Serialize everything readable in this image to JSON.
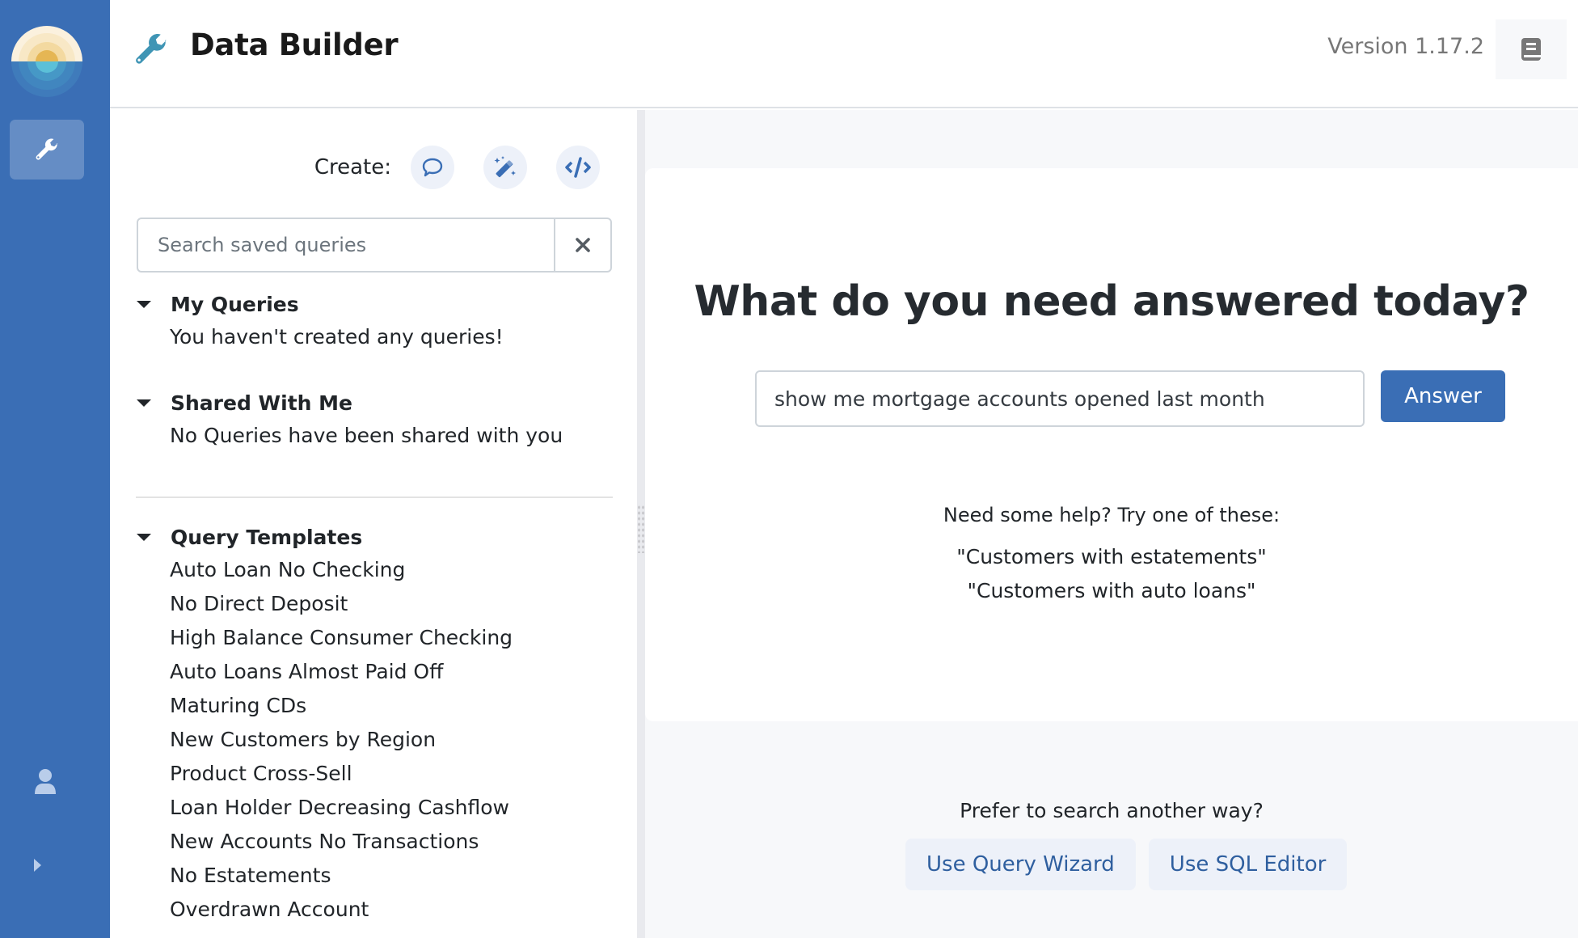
{
  "app": {
    "title": "Data Builder",
    "version": "Version 1.17.2",
    "colors": {
      "brand": "#3a6eb5",
      "accent_icon": "#3f95b5",
      "soft_button": "#edf1f9"
    }
  },
  "rail": {
    "items": [
      {
        "icon": "wrench-icon",
        "label": "Data Builder",
        "active": true
      },
      {
        "icon": "user-icon",
        "label": "Profile"
      },
      {
        "icon": "chevron-right-icon",
        "label": "Expand"
      }
    ]
  },
  "header": {
    "docs_button_icon": "book-icon"
  },
  "left": {
    "create_label": "Create:",
    "create_buttons": [
      {
        "icon": "chat-bubble-icon",
        "label": "Natural language query"
      },
      {
        "icon": "magic-wand-icon",
        "label": "Query wizard"
      },
      {
        "icon": "code-icon",
        "label": "SQL editor"
      }
    ],
    "search": {
      "placeholder": "Search saved queries",
      "value": ""
    },
    "sections": {
      "my_queries": {
        "title": "My Queries",
        "empty": "You haven't created any queries!"
      },
      "shared": {
        "title": "Shared With Me",
        "empty": "No Queries have been shared with you"
      },
      "templates": {
        "title": "Query Templates",
        "items": [
          "Auto Loan No Checking",
          "No Direct Deposit",
          "High Balance Consumer Checking",
          "Auto Loans Almost Paid Off",
          "Maturing CDs",
          "New Customers by Region",
          "Product Cross-Sell",
          "Loan Holder Decreasing Cashflow",
          "New Accounts No Transactions",
          "No Estatements",
          "Overdrawn Account"
        ]
      }
    }
  },
  "main": {
    "headline": "What do you need answered today?",
    "question_input": {
      "value": "show me mortgage accounts opened last month",
      "placeholder": ""
    },
    "answer_button": "Answer",
    "help_text": "Need some help? Try one of these:",
    "suggestions": [
      "\"Customers with estatements\"",
      "\"Customers with auto loans\""
    ],
    "prefer_text": "Prefer to search another way?",
    "alt_buttons": [
      "Use Query Wizard",
      "Use SQL Editor"
    ]
  }
}
